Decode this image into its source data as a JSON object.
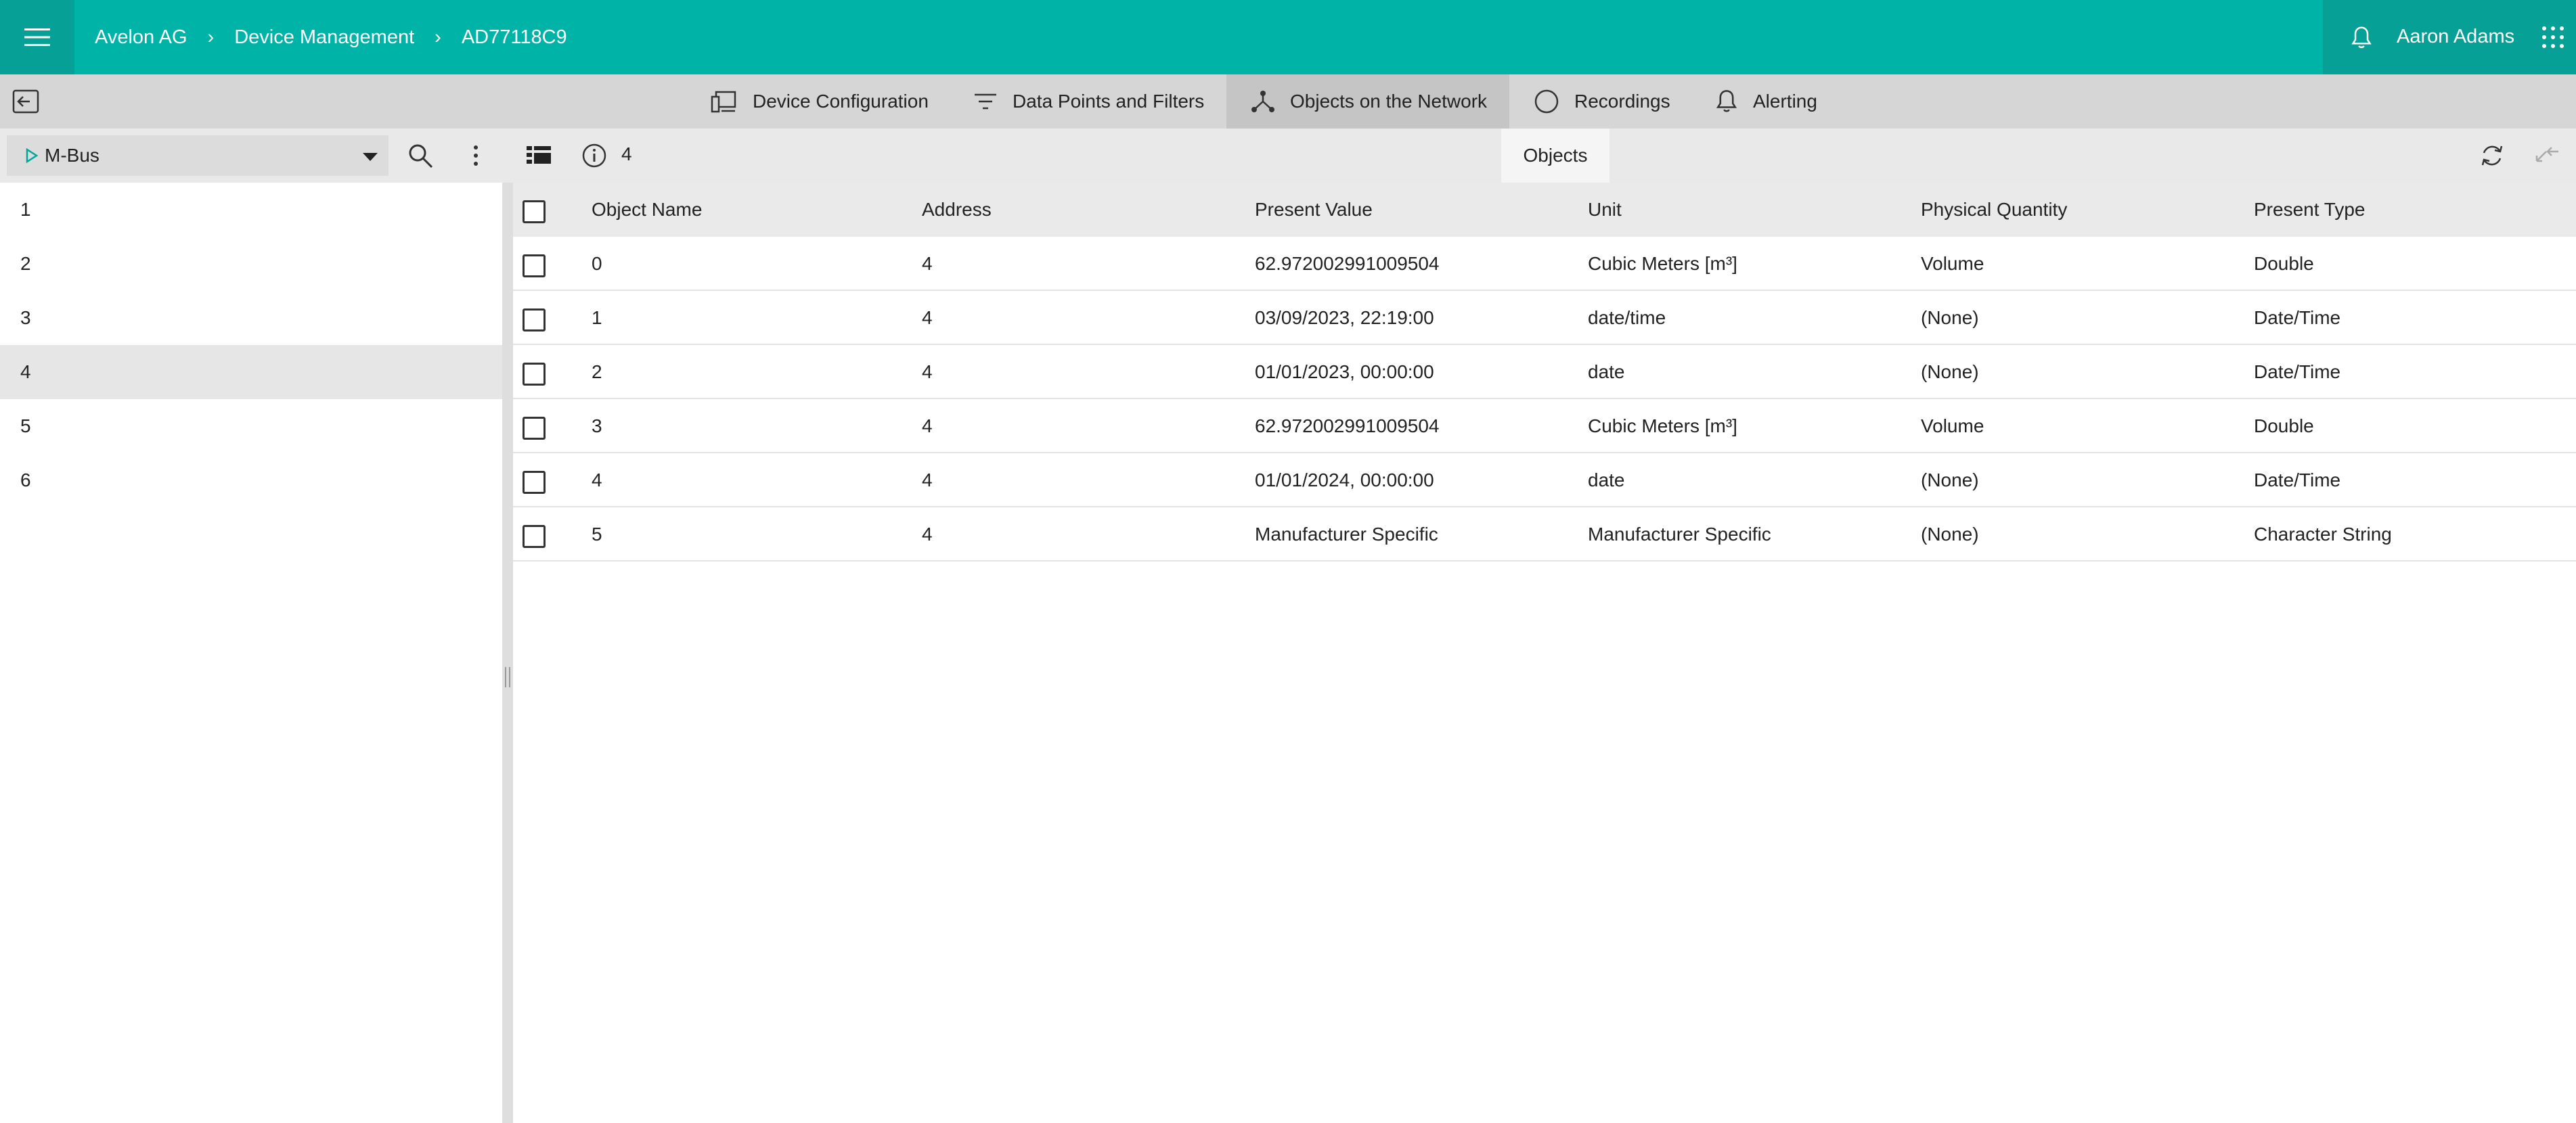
{
  "header": {
    "breadcrumb": [
      "Avelon AG",
      "Device Management",
      "AD77118C9"
    ],
    "separator": "›",
    "user": "Aaron Adams"
  },
  "tabs": [
    {
      "label": "Device Configuration",
      "icon": "devices-icon"
    },
    {
      "label": "Data Points and Filters",
      "icon": "filter-icon"
    },
    {
      "label": "Objects on the Network",
      "icon": "network-icon",
      "active": true
    },
    {
      "label": "Recordings",
      "icon": "circle-icon"
    },
    {
      "label": "Alerting",
      "icon": "bell-icon"
    }
  ],
  "toolbar": {
    "bus_select": "M-Bus",
    "info_count": "4",
    "objects_tab": "Objects"
  },
  "left_list": [
    "1",
    "2",
    "3",
    "4",
    "5",
    "6"
  ],
  "left_selected": "4",
  "table": {
    "columns": [
      "Object Name",
      "Address",
      "Present Value",
      "Unit",
      "Physical Quantity",
      "Present Type"
    ],
    "rows": [
      [
        "0",
        "4",
        "62.972002991009504",
        "Cubic Meters [m³]",
        "Volume",
        "Double"
      ],
      [
        "1",
        "4",
        "03/09/2023, 22:19:00",
        "date/time",
        "(None)",
        "Date/Time"
      ],
      [
        "2",
        "4",
        "01/01/2023, 00:00:00",
        "date",
        "(None)",
        "Date/Time"
      ],
      [
        "3",
        "4",
        "62.972002991009504",
        "Cubic Meters [m³]",
        "Volume",
        "Double"
      ],
      [
        "4",
        "4",
        "01/01/2024, 00:00:00",
        "date",
        "(None)",
        "Date/Time"
      ],
      [
        "5",
        "4",
        "Manufacturer Specific",
        "Manufacturer Specific",
        "(None)",
        "Character String"
      ]
    ]
  },
  "colors": {
    "header": "#00b3a7",
    "header_dark": "#06a096",
    "accent": "#00b3a7"
  }
}
